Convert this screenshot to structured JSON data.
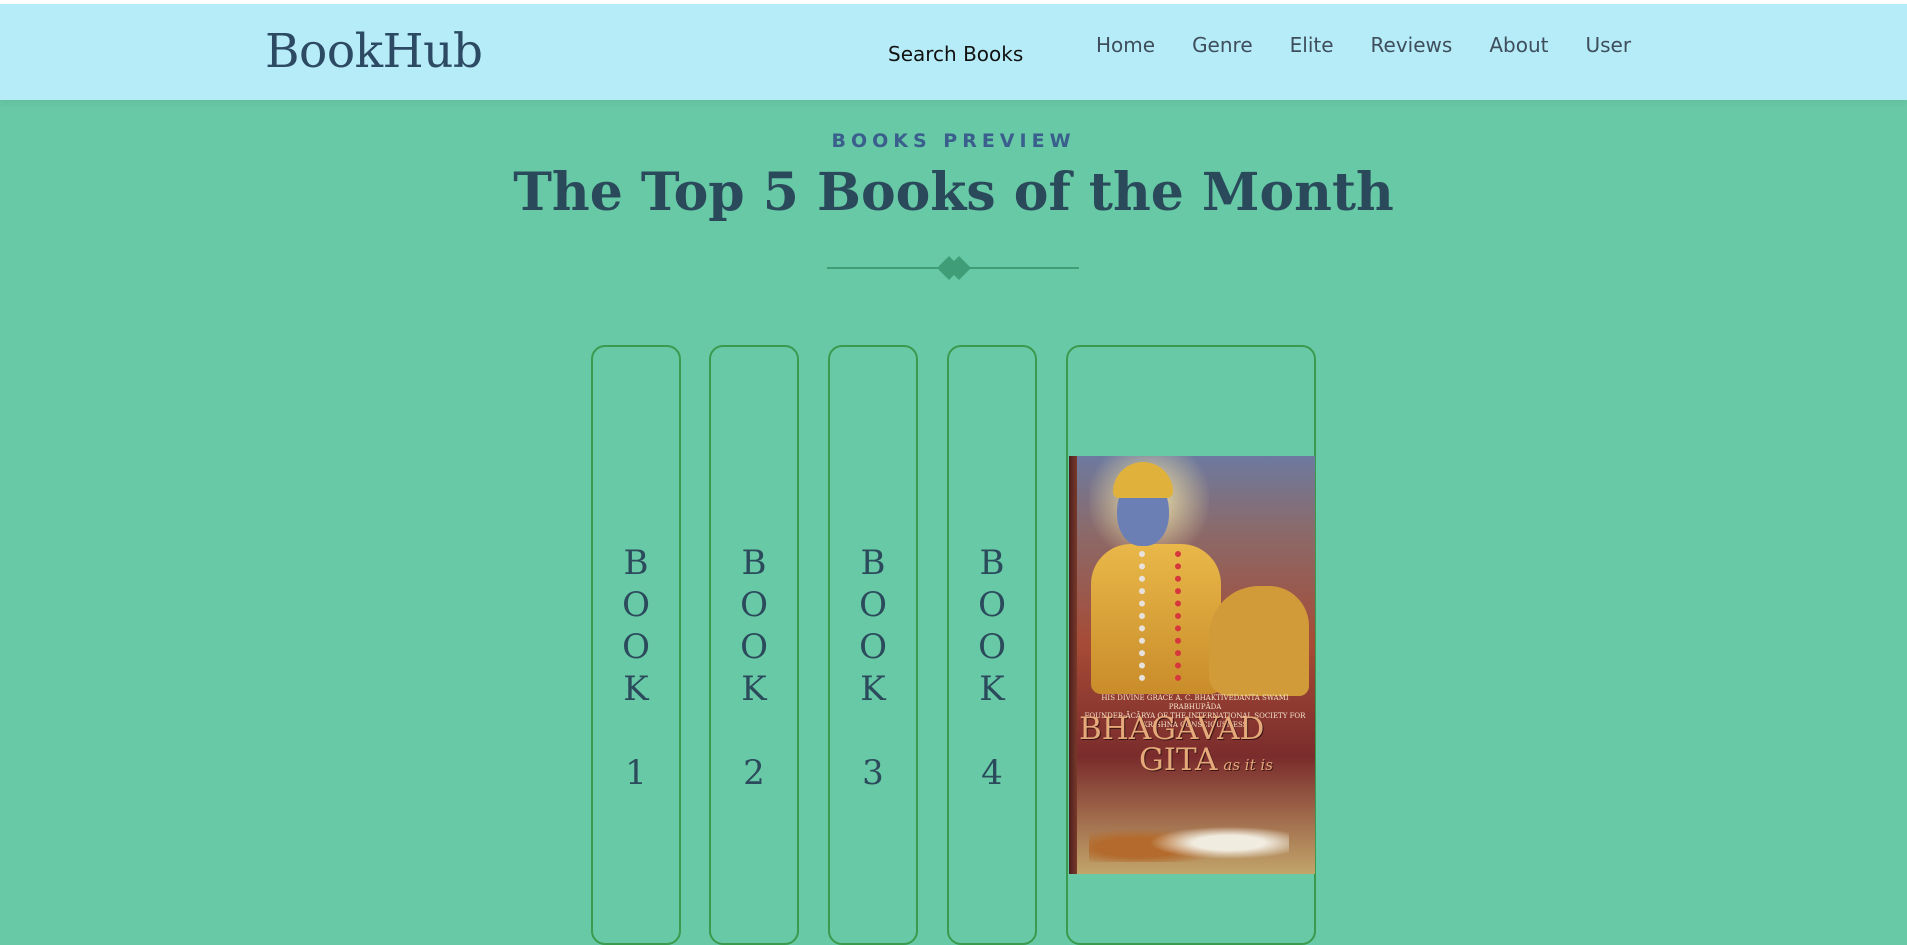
{
  "navbar": {
    "brand": "BookHub",
    "search_label": "Search Books",
    "links": [
      "Home",
      "Genre",
      "Elite",
      "Reviews",
      "About",
      "User"
    ]
  },
  "section": {
    "eyebrow": "BOOKS PREVIEW",
    "title": "The Top 5 Books of the Month"
  },
  "books": [
    {
      "label": "B\nO\nO\nK\n\n1"
    },
    {
      "label": "B\nO\nO\nK\n\n2"
    },
    {
      "label": "B\nO\nO\nK\n\n3"
    },
    {
      "label": "B\nO\nO\nK\n\n4"
    }
  ],
  "featured_cover": {
    "byline": "HIS DIVINE GRACE A. C. BHAKTIVEDANTA SWAMI PRABHUPĀDA\nFOUNDER-ĀCĀRYA OF THE INTERNATIONAL SOCIETY FOR KRISHNA CONSCIOUSNESS",
    "title_line1": "BHAGAVAD",
    "title_line2": "GITA",
    "subtitle": "as it is"
  },
  "colors": {
    "page_background": "#68c9a6",
    "navbar_background": "#b6ecf8",
    "heading_text": "#2a4a5b",
    "eyebrow_text": "#3a5f8d",
    "book_border": "#3a9a4e"
  }
}
